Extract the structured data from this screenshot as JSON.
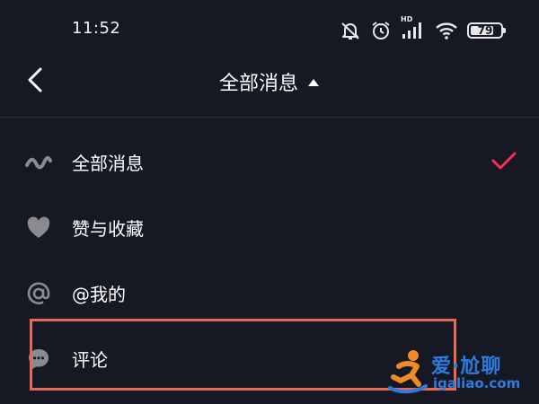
{
  "status_bar": {
    "time": "11:52",
    "network_label": "HD",
    "battery_percent": 79,
    "battery_text": "79",
    "icons": [
      "mute-bell-icon",
      "alarm-icon",
      "cellular-signal-icon",
      "wifi-icon",
      "battery-icon"
    ]
  },
  "nav": {
    "back_icon": "chevron-left-icon",
    "title": "全部消息",
    "dropdown_icon": "caret-up-icon"
  },
  "menu": {
    "items": [
      {
        "label": "全部消息",
        "icon": "wave-icon",
        "selected": true
      },
      {
        "label": "赞与收藏",
        "icon": "heart-icon",
        "selected": false
      },
      {
        "label": "@我的",
        "icon": "at-icon",
        "selected": false
      },
      {
        "label": "评论",
        "icon": "comment-icon",
        "selected": false
      }
    ],
    "check_icon": "checkmark-icon"
  },
  "watermark": {
    "title": "爱·尬聊",
    "url": "igaliao.com"
  },
  "colors": {
    "background": "#161823",
    "accent_check": "#fe2c55",
    "icon_gray": "#8a8b91",
    "highlight_border": "#e56a54",
    "watermark_blue": "#2d7be0"
  }
}
